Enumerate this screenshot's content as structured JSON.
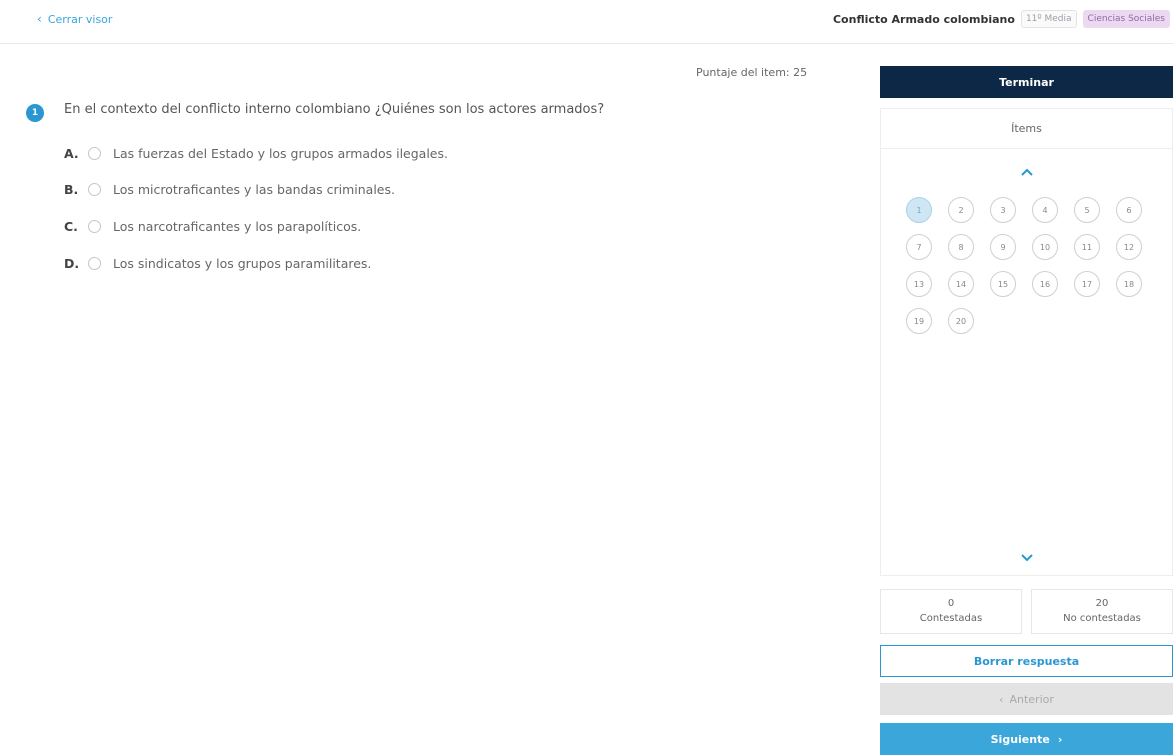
{
  "header": {
    "close_label": "Cerrar visor",
    "test_title": "Conflicto Armado colombiano",
    "level_tag": "11º Media",
    "subject_tag": "Ciencias Sociales"
  },
  "question": {
    "score_label": "Puntaje del item: 25",
    "number": "1",
    "text": "En el contexto del conflicto interno colombiano ¿Quiénes son los actores armados?",
    "options": [
      {
        "letter": "A.",
        "text": "Las fuerzas del Estado y los grupos armados ilegales."
      },
      {
        "letter": "B.",
        "text": "Los microtraficantes y las bandas criminales."
      },
      {
        "letter": "C.",
        "text": "Los narcotraficantes y los parapolíticos."
      },
      {
        "letter": "D.",
        "text": "Los sindicatos y los grupos paramilitares."
      }
    ]
  },
  "sidebar": {
    "finish_label": "Terminar",
    "items_title": "Ítems",
    "items": [
      "1",
      "2",
      "3",
      "4",
      "5",
      "6",
      "7",
      "8",
      "9",
      "10",
      "11",
      "12",
      "13",
      "14",
      "15",
      "16",
      "17",
      "18",
      "19",
      "20"
    ],
    "current_item": "1",
    "answered_count": "0",
    "answered_label": "Contestadas",
    "unanswered_count": "20",
    "unanswered_label": "No contestadas",
    "clear_label": "Borrar respuesta",
    "prev_label": "Anterior",
    "next_label": "Siguiente"
  },
  "colors": {
    "primary": "#2a97d2",
    "dark_navy": "#0d2747",
    "subject_tag_bg": "#ead9f1"
  }
}
